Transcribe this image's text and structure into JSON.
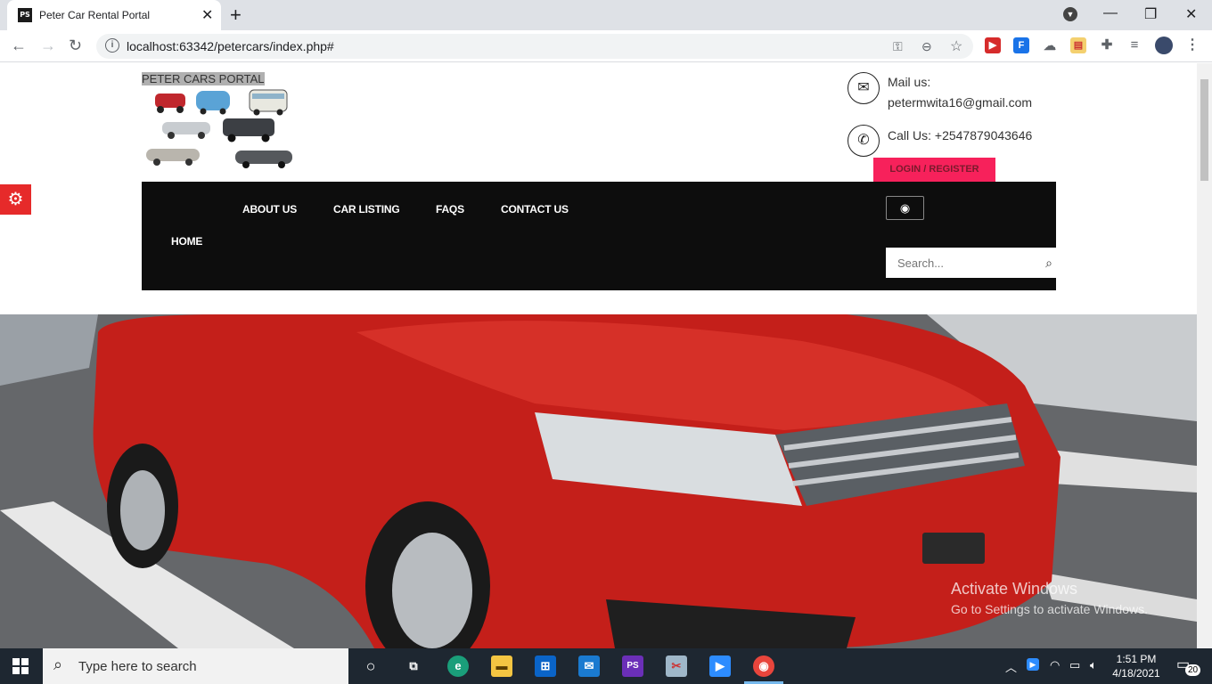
{
  "browser": {
    "tab_title": "Peter Car Rental Portal",
    "tab_favicon": "PS",
    "url": "localhost:63342/petercars/index.php#",
    "new_tab": "+",
    "window_minimize": "—",
    "window_restore": "❐",
    "window_close": "✕"
  },
  "site": {
    "brand": "PETER CARS PORTAL",
    "mail_label": "Mail us:",
    "mail_value": "petermwita16@gmail.com",
    "call_text": "Call Us: +2547879043646",
    "login_label": "LOGIN / REGISTER",
    "nav": {
      "about": "ABOUT US",
      "listing": "CAR LISTING",
      "faqs": "FAQS",
      "contact": "CONTACT US",
      "home": "HOME"
    },
    "search_placeholder": "Search...",
    "accent_color": "#f7215b",
    "nav_bg": "#0d0d0d"
  },
  "watermark": {
    "line1": "Activate Windows",
    "line2": "Go to Settings to activate Windows."
  },
  "taskbar": {
    "search_placeholder": "Type here to search",
    "time": "1:51 PM",
    "date": "4/18/2021",
    "notifications": "20"
  }
}
